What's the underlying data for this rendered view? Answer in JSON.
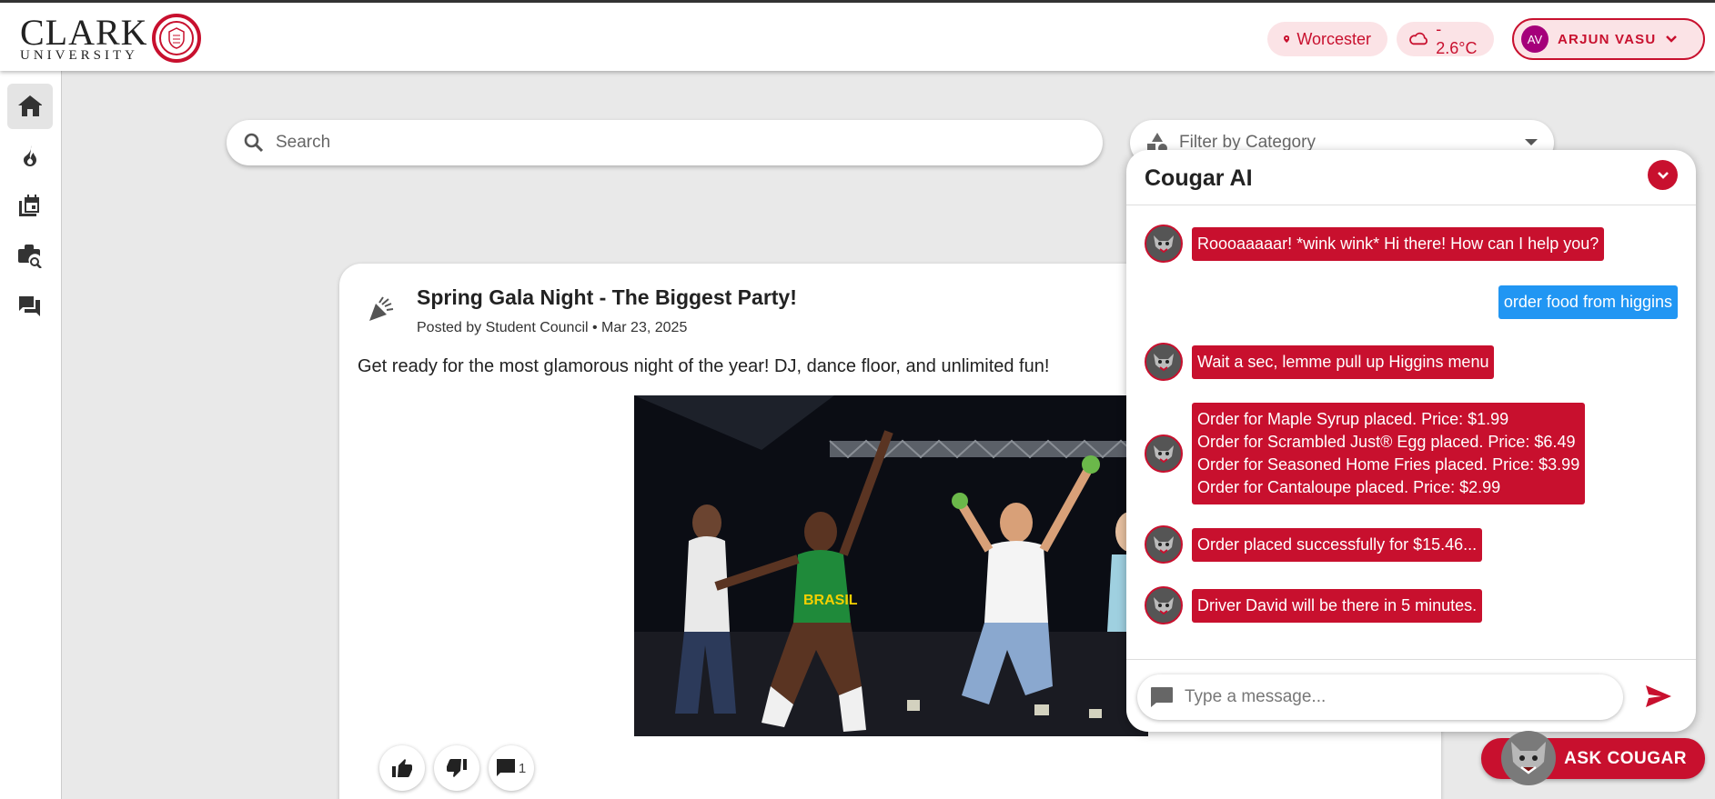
{
  "brand": {
    "name_big": "CLARK",
    "name_small": "UNIVERSITY"
  },
  "header": {
    "location": "Worcester",
    "weather": "- 2.6°C",
    "user_initials": "AV",
    "user_name": "ARJUN VASU"
  },
  "sidebar": {
    "items": [
      {
        "icon": "home-icon",
        "active": true
      },
      {
        "icon": "fire-icon",
        "active": false
      },
      {
        "icon": "events-icon",
        "active": false
      },
      {
        "icon": "job-search-icon",
        "active": false
      },
      {
        "icon": "forum-icon",
        "active": false
      }
    ]
  },
  "search": {
    "placeholder": "Search"
  },
  "filter": {
    "placeholder": "Filter by Category"
  },
  "post": {
    "title": "Spring Gala Night - The Biggest Party!",
    "meta": "Posted by Student Council • Mar 23, 2025",
    "body": "Get ready for the most glamorous night of the year! DJ, dance floor, and unlimited fun!",
    "comment_count": "1"
  },
  "chat": {
    "title": "Cougar AI",
    "messages": [
      {
        "from": "bot",
        "text": "Roooaaaaar! *wink wink* Hi there! How can I help you?"
      },
      {
        "from": "user",
        "text": "order food from higgins"
      },
      {
        "from": "bot",
        "text": "Wait a sec, lemme pull up Higgins menu"
      },
      {
        "from": "bot",
        "lines": [
          "Order for Maple Syrup placed. Price: $1.99",
          "Order for Scrambled Just® Egg placed. Price: $6.49",
          "Order for Seasoned Home Fries placed. Price: $3.99",
          "Order for Cantaloupe placed. Price: $2.99"
        ]
      },
      {
        "from": "bot",
        "text": "Order placed successfully for $15.46..."
      },
      {
        "from": "bot",
        "text": "Driver David will be there in 5 minutes."
      }
    ],
    "input_placeholder": "Type a message..."
  },
  "ask_button": {
    "label": "ASK COUGAR"
  },
  "colors": {
    "brand_red": "#c8102e",
    "user_blue": "#2196f3"
  }
}
